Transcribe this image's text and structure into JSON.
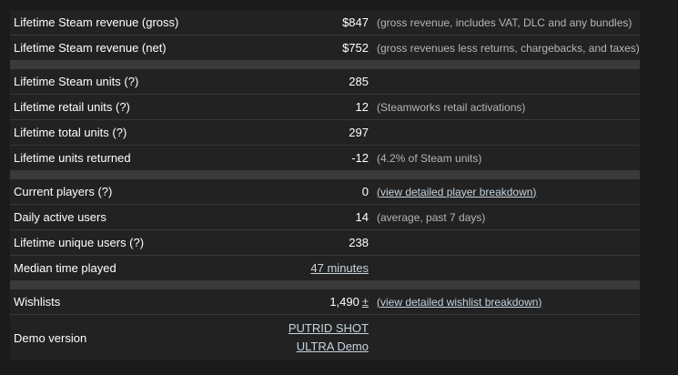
{
  "revenue": {
    "gross": {
      "label": "Lifetime Steam revenue (gross)",
      "value": "$847",
      "note": "(gross revenue, includes VAT, DLC and any bundles)"
    },
    "net": {
      "label": "Lifetime Steam revenue (net)",
      "value": "$752",
      "note": "(gross revenues less returns, chargebacks, and taxes)"
    }
  },
  "units": {
    "steam": {
      "label": "Lifetime Steam units (?)",
      "value": "285"
    },
    "retail": {
      "label": "Lifetime retail units (?)",
      "value": "12",
      "note": "(Steamworks retail activations)"
    },
    "total": {
      "label": "Lifetime total units (?)",
      "value": "297"
    },
    "returned": {
      "label": "Lifetime units returned",
      "value": "-12",
      "note": "(4.2% of Steam units)"
    }
  },
  "players": {
    "current": {
      "label": "Current players (?)",
      "value": "0",
      "link": "(view detailed player breakdown)"
    },
    "daily": {
      "label": "Daily active users",
      "value": "14",
      "note": "(average, past 7 days)"
    },
    "unique": {
      "label": "Lifetime unique users (?)",
      "value": "238"
    },
    "median": {
      "label": "Median time played",
      "value": "47 minutes"
    }
  },
  "wishlist": {
    "wishlists": {
      "label": "Wishlists",
      "value": "1,490",
      "plusminus": "±",
      "link": "(view detailed wishlist breakdown)"
    },
    "demo": {
      "label": "Demo version",
      "line1": "PUTRID SHOT",
      "line2": "ULTRA Demo"
    }
  },
  "colors": {
    "background": "#1b1b1b",
    "row": "#222222",
    "separator": "#3a3a3a",
    "link": "#c6d4df",
    "note": "#b5b5b5"
  }
}
